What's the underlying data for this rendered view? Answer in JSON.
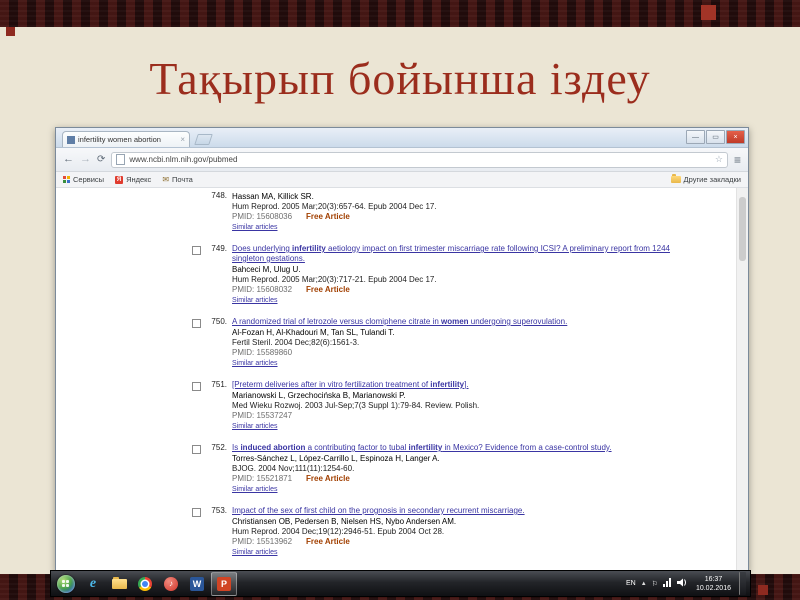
{
  "slide": {
    "title": "Тақырып бойынша іздеу"
  },
  "browser": {
    "tab_title": "infertility women abortion",
    "url": "www.ncbi.nlm.nih.gov/pubmed",
    "bookmarks": {
      "services": "Сервисы",
      "yandex": "Яндекс",
      "yandex_initial": "Я",
      "mail": "Почта",
      "other": "Другие закладки"
    },
    "icons": {
      "back": "←",
      "forward": "→",
      "reload": "⟳",
      "star": "☆",
      "menu": "≡",
      "tab_close": "×",
      "win_min": "—",
      "win_max": "▭",
      "win_close": "×",
      "mail_glyph": "✉"
    }
  },
  "results": [
    {
      "number": "748.",
      "partial": true,
      "authors": "Hassan MA, Killick SR.",
      "journal": "Hum Reprod. 2005 Mar;20(3):657-64. Epub 2004 Dec 17.",
      "pmid": "PMID: 15608036",
      "free": "Free Article",
      "similar": "Similar articles"
    },
    {
      "number": "749.",
      "title_parts": [
        {
          "t": "Does underlying "
        },
        {
          "t": "infertility",
          "b": true
        },
        {
          "t": " aetiology impact on first trimester miscarriage rate following ICSI? A preliminary report from 1244 singleton gestations."
        }
      ],
      "authors": "Bahceci M, Ulug U.",
      "journal": "Hum Reprod. 2005 Mar;20(3):717-21. Epub 2004 Dec 17.",
      "pmid": "PMID: 15608032",
      "free": "Free Article",
      "similar": "Similar articles"
    },
    {
      "number": "750.",
      "title_parts": [
        {
          "t": "A randomized trial of letrozole versus clomiphene citrate in "
        },
        {
          "t": "women",
          "b": true
        },
        {
          "t": " undergoing superovulation."
        }
      ],
      "authors": "Al-Fozan H, Al-Khadouri M, Tan SL, Tulandi T.",
      "journal": "Fertil Steril. 2004 Dec;82(6):1561-3.",
      "pmid": "PMID: 15589860",
      "similar": "Similar articles"
    },
    {
      "number": "751.",
      "title_parts": [
        {
          "t": "[Preterm deliveries after in vitro fertilization treatment of "
        },
        {
          "t": "infertility",
          "b": true
        },
        {
          "t": "]."
        }
      ],
      "authors": "Marianowski L, Grzechocińska B, Marianowski P.",
      "journal": "Med Wieku Rozwoj. 2003 Jul-Sep;7(3 Suppl 1):79-84. Review. Polish.",
      "pmid": "PMID: 15537247",
      "similar": "Similar articles"
    },
    {
      "number": "752.",
      "title_parts": [
        {
          "t": "Is "
        },
        {
          "t": "induced abortion",
          "b": true
        },
        {
          "t": " a contributing factor to tubal "
        },
        {
          "t": "infertility",
          "b": true
        },
        {
          "t": " in Mexico? Evidence from a case-control study."
        }
      ],
      "authors": "Torres-Sánchez L, López-Carrillo L, Espinoza H, Langer A.",
      "journal": "BJOG. 2004 Nov;111(11):1254-60.",
      "pmid": "PMID: 15521871",
      "free": "Free Article",
      "similar": "Similar articles"
    },
    {
      "number": "753.",
      "title_parts": [
        {
          "t": "Impact of the sex of first child on the prognosis in secondary recurrent miscarriage."
        }
      ],
      "authors": "Christiansen OB, Pedersen B, Nielsen HS, Nybo Andersen AM.",
      "journal": "Hum Reprod. 2004 Dec;19(12):2946-51. Epub 2004 Oct 28.",
      "pmid": "PMID: 15513962",
      "free": "Free Article",
      "similar": "Similar articles"
    }
  ],
  "taskbar": {
    "lang": "EN",
    "time": "16:37",
    "date": "10.02.2016",
    "icons": {
      "ie": "e",
      "word": "W",
      "powerpoint": "P",
      "media": "♪",
      "tray_up": "▲",
      "flag": "⚐"
    }
  }
}
